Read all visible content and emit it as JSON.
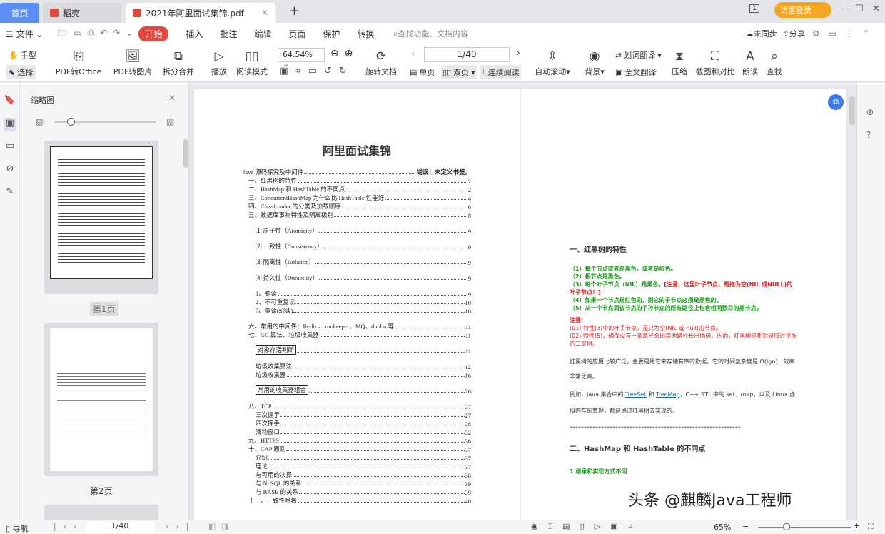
{
  "tabs": {
    "home": "首页",
    "daoke": "稻壳",
    "document": "2021年阿里面试集锦.pdf"
  },
  "window": {
    "login": "访客登录",
    "page_indicator": "1"
  },
  "menu": {
    "file": "文件",
    "items": [
      "开始",
      "插入",
      "批注",
      "编辑",
      "页面",
      "保护",
      "转换"
    ],
    "search_placeholder": "查找功能、文档内容",
    "sync": "未同步",
    "share": "分享"
  },
  "toolbar": {
    "hand": "手型",
    "select": "选择",
    "pdf_to_office": "PDF转Office",
    "pdf_to_image": "PDF转图片",
    "split_merge": "拆分合并",
    "play": "播放",
    "read_mode": "阅读模式",
    "zoom": "64.54%",
    "rotate_doc": "旋转文档",
    "page_value": "1/40",
    "single": "单页",
    "double": "双页",
    "continuous": "连续阅读",
    "auto_scroll": "自动滚动",
    "background": "背景",
    "word_translate": "划词翻译",
    "full_translate": "全文翻译",
    "compress": "压缩",
    "screenshot_compare": "截图和对比",
    "read_aloud": "朗读",
    "find": "查找"
  },
  "thumbnails": {
    "title": "缩略图",
    "pages": [
      "第1页",
      "第2页"
    ]
  },
  "page1": {
    "title": "阿里面试集锦",
    "toc": [
      {
        "t": "Java 源码探究及中间件",
        "p": "错误！未定义书签。",
        "lvl": 0
      },
      {
        "t": "一、红黑树的特性",
        "p": "2",
        "lvl": 1
      },
      {
        "t": "二、HashMap 和 HashTable 的不同点",
        "p": "2",
        "lvl": 1
      },
      {
        "t": "三、ConcurrentHashMap 为什么比 HashTable 性能好",
        "p": "4",
        "lvl": 1
      },
      {
        "t": "四、ClassLoader 的分类及加载顺序",
        "p": "6",
        "lvl": 1
      },
      {
        "t": "五、数据库事物特性及隔离级别",
        "p": "8",
        "lvl": 1
      },
      {
        "t": "⑴ 原子性（Atomicity）",
        "p": "9",
        "lvl": 2,
        "gap": true
      },
      {
        "t": "⑵ 一致性（Consistency）",
        "p": "9",
        "lvl": 2,
        "gap": true
      },
      {
        "t": "⑶ 隔离性（Isolation）",
        "p": "9",
        "lvl": 2,
        "gap": true
      },
      {
        "t": "⑷ 持久性（Durability）",
        "p": "9",
        "lvl": 2,
        "gap": true
      },
      {
        "t": "1、脏读",
        "p": "9",
        "lvl": 2,
        "gap": true
      },
      {
        "t": "2、不可重复读",
        "p": "10",
        "lvl": 2
      },
      {
        "t": "3、虚读(幻读)",
        "p": "10",
        "lvl": 2
      },
      {
        "t": "六、常用的中间件：Redis 、zookeeper、MQ、dubbo 等",
        "p": "11",
        "lvl": 1,
        "gap": true
      },
      {
        "t": "七、GC 算法、垃圾收集器",
        "p": "11",
        "lvl": 1
      },
      {
        "t": "对象存活判断",
        "p": "11",
        "lvl": 2,
        "box": true,
        "gap": true
      },
      {
        "t": "垃圾收集算法",
        "p": "12",
        "lvl": 2,
        "gap": true
      },
      {
        "t": "垃圾收集器",
        "p": "16",
        "lvl": 2
      },
      {
        "t": "常用的收集器组合",
        "p": "26",
        "lvl": 2,
        "box": true,
        "gap": true
      },
      {
        "t": "八、TCP",
        "p": "27",
        "lvl": 1,
        "gap": true
      },
      {
        "t": "三次握手",
        "p": "27",
        "lvl": 2
      },
      {
        "t": "四次挥手",
        "p": "28",
        "lvl": 2
      },
      {
        "t": "滑动窗口",
        "p": "32",
        "lvl": 2
      },
      {
        "t": "九、HTTPS",
        "p": "36",
        "lvl": 1
      },
      {
        "t": "十、CAP 原则",
        "p": "37",
        "lvl": 1
      },
      {
        "t": "介绍",
        "p": "37",
        "lvl": 2
      },
      {
        "t": "理论",
        "p": "37",
        "lvl": 2
      },
      {
        "t": "与可用的决择",
        "p": "38",
        "lvl": 2
      },
      {
        "t": "与 NoSQL 的关系",
        "p": "39",
        "lvl": 2
      },
      {
        "t": "与 BASE 的关系",
        "p": "39",
        "lvl": 2
      },
      {
        "t": "十一、一致性哈希",
        "p": "40",
        "lvl": 1
      }
    ]
  },
  "page2": {
    "h1": "一、红黑树的特性",
    "g1": "（1）每个节点或者是黑色，或者是红色。",
    "g2": "（2）根节点是黑色。",
    "g3": "（3）每个叶子节点（NIL）是黑色。",
    "r3": "[注意：这里叶子节点，是指为空(NIL 或NULL)的叶子节点！]",
    "g4": "（4）如果一个节点是红色的，则它的子节点必须是黑色的。",
    "g5": "（5）从一个节点到该节点的子孙节点的所有路径上包含相同数目的黑节点。",
    "note": "注意:",
    "n1": "(01) 特性(3)中的叶子节点，是只为空(NIL 或 null)的节点。",
    "n2": "(02) 特性(5)，确保没有一条路径会比其他路径长出俩倍。因而，红黑树是相对是接近平衡的二叉树。",
    "body1": "红黑树的应用比较广泛，主要是用它来存储有序的数据，它的时间复杂度是 O(lgn)，效率",
    "body1b": "非常之高。",
    "body2a": "例如，Java 集合中的 ",
    "link1": "TreeSet",
    "body2b": " 和 ",
    "link2": "TreeMap",
    "body2c": "，C++ STL 中的 set、map，以及 Linux 虚",
    "body3": "拟内存的管理，都是通过红黑树去实现的。",
    "stars": "************************************************************",
    "h2": "二、HashMap 和 HashTable 的不同点",
    "sub1": "1  继承和实现方式不同"
  },
  "watermark": "头条 @麒麟Java工程师",
  "status": {
    "nav": "导航",
    "page": "1/40",
    "zoom": "65%"
  }
}
